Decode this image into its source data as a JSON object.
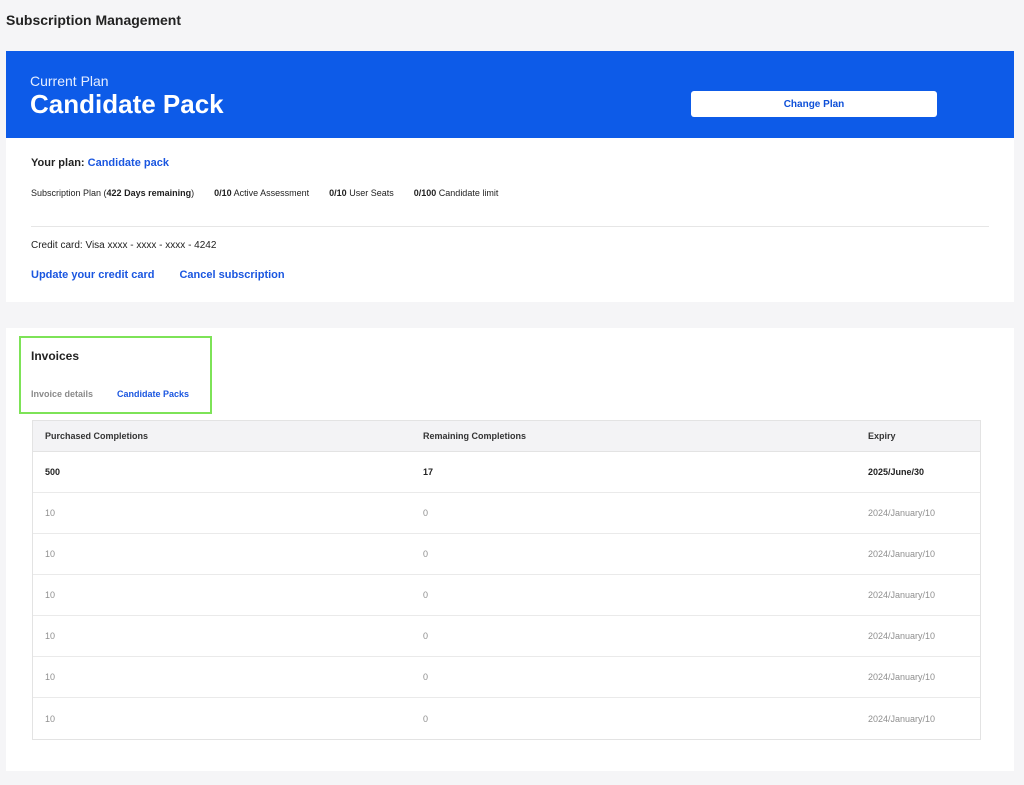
{
  "page": {
    "title": "Subscription Management"
  },
  "plan": {
    "banner_subtitle": "Current Plan",
    "banner_title": "Candidate Pack",
    "change_plan_label": "Change Plan",
    "your_plan_label": "Your plan:",
    "your_plan_value": "Candidate pack",
    "stats": {
      "subscription_prefix": "Subscription Plan (",
      "days_remaining": "422 Days remaining",
      "subscription_suffix": ")",
      "assessments_count": "0/10",
      "assessments_label": "Active Assessment",
      "seats_count": "0/10",
      "seats_label": "User Seats",
      "candidates_count": "0/100",
      "candidates_label": "Candidate limit"
    },
    "credit_card": "Credit card: Visa xxxx - xxxx - xxxx - 4242",
    "update_card_label": "Update your credit card",
    "cancel_label": "Cancel subscription"
  },
  "invoices": {
    "title": "Invoices",
    "tabs": [
      {
        "label": "Invoice details",
        "active": false
      },
      {
        "label": "Candidate Packs",
        "active": true
      }
    ],
    "columns": [
      "Purchased Completions",
      "Remaining Completions",
      "Expiry"
    ],
    "rows": [
      {
        "purchased": "500",
        "remaining": "17",
        "expiry": "2025/June/30"
      },
      {
        "purchased": "10",
        "remaining": "0",
        "expiry": "2024/January/10"
      },
      {
        "purchased": "10",
        "remaining": "0",
        "expiry": "2024/January/10"
      },
      {
        "purchased": "10",
        "remaining": "0",
        "expiry": "2024/January/10"
      },
      {
        "purchased": "10",
        "remaining": "0",
        "expiry": "2024/January/10"
      },
      {
        "purchased": "10",
        "remaining": "0",
        "expiry": "2024/January/10"
      },
      {
        "purchased": "10",
        "remaining": "0",
        "expiry": "2024/January/10"
      }
    ]
  },
  "colors": {
    "brand_blue": "#0d5be8",
    "link_blue": "#1a56e0",
    "highlight_green": "#7de357"
  }
}
